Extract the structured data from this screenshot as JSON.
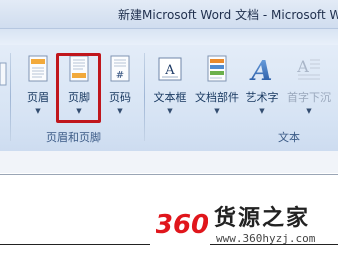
{
  "window": {
    "title": "新建Microsoft Word 文档 - Microsoft W"
  },
  "ribbon": {
    "header_footer_group": {
      "label": "页眉和页脚",
      "buttons": [
        {
          "label": "页眉",
          "icon": "header-icon"
        },
        {
          "label": "页脚",
          "icon": "footer-icon"
        },
        {
          "label": "页码",
          "icon": "page-number-icon"
        }
      ]
    },
    "text_group": {
      "label": "文本",
      "buttons": [
        {
          "label": "文本框",
          "icon": "text-box-icon"
        },
        {
          "label": "文档部件",
          "icon": "quick-parts-icon"
        },
        {
          "label": "艺术字",
          "icon": "wordart-icon"
        },
        {
          "label": "首字下沉",
          "icon": "drop-cap-icon",
          "disabled": true
        }
      ]
    }
  },
  "watermark": {
    "logo_text": "360",
    "brand": "货源之家",
    "url": "www.360hyzj.com"
  },
  "colors": {
    "highlight": "#c0161c",
    "logo_red": "#e0161c",
    "ribbon_bg": "#d7e4f4"
  }
}
